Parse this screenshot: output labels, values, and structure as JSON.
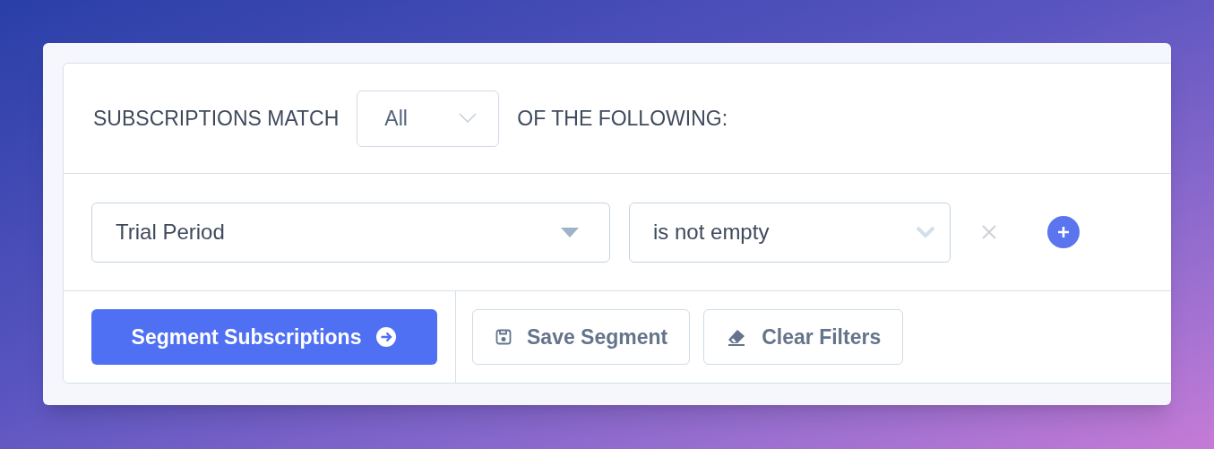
{
  "match": {
    "prefix": "SUBSCRIPTIONS MATCH",
    "select_value": "All",
    "suffix": "OF THE FOLLOWING:"
  },
  "filters": [
    {
      "field": "Trial Period",
      "operator": "is not empty"
    }
  ],
  "actions": {
    "primary": "Segment Subscriptions",
    "buttons": [
      {
        "kind": "save",
        "label": "Save Segment"
      },
      {
        "kind": "clear",
        "label": "Clear Filters"
      }
    ]
  }
}
